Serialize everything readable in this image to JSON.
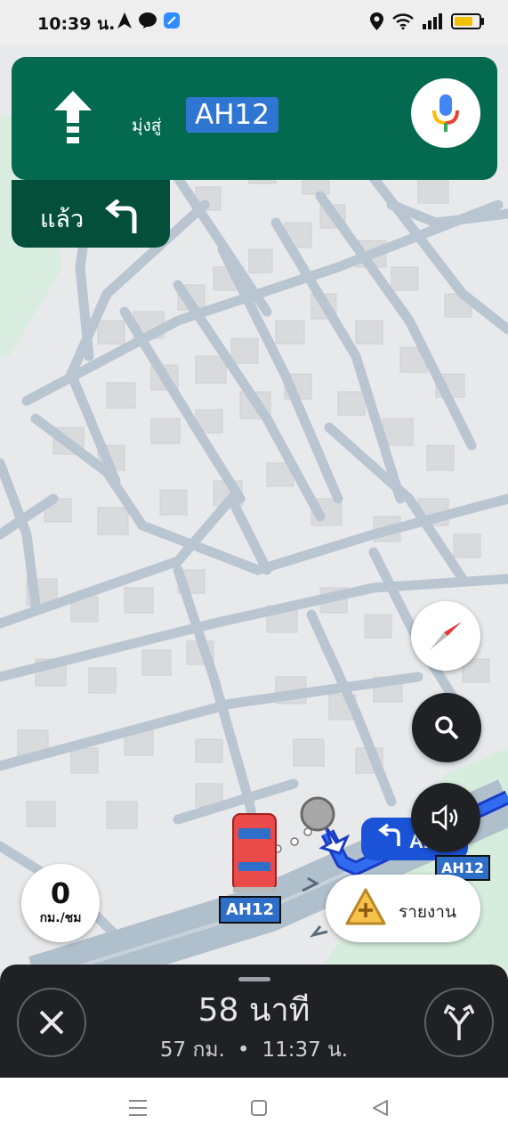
{
  "status_bar": {
    "time": "10:39 น.",
    "left_icons": [
      "navigation-icon",
      "line-icon",
      "app-icon"
    ],
    "right_icons": [
      "location-icon",
      "wifi-icon",
      "signal-icon",
      "battery-icon"
    ],
    "battery_level": 0.8,
    "battery_color": "#f2c200"
  },
  "navigation": {
    "maneuver": "straight",
    "toward_label": "มุ่งสู่",
    "route_name": "AH12",
    "then_label": "แล้ว",
    "then_maneuver": "turn-left"
  },
  "map": {
    "route_shields": [
      "AH12",
      "AH12"
    ],
    "turn_badge": "AH12"
  },
  "speed": {
    "value": "0",
    "unit": "กม./ชม"
  },
  "report": {
    "label": "รายงาน"
  },
  "trip": {
    "duration": "58 นาที",
    "distance": "57 กม.",
    "separator": "•",
    "eta": "11:37 น."
  },
  "colors": {
    "banner": "#046a4f",
    "banner_dark": "#034f3a",
    "route_blue": "#2f76d2",
    "bottom_sheet": "#202124"
  }
}
